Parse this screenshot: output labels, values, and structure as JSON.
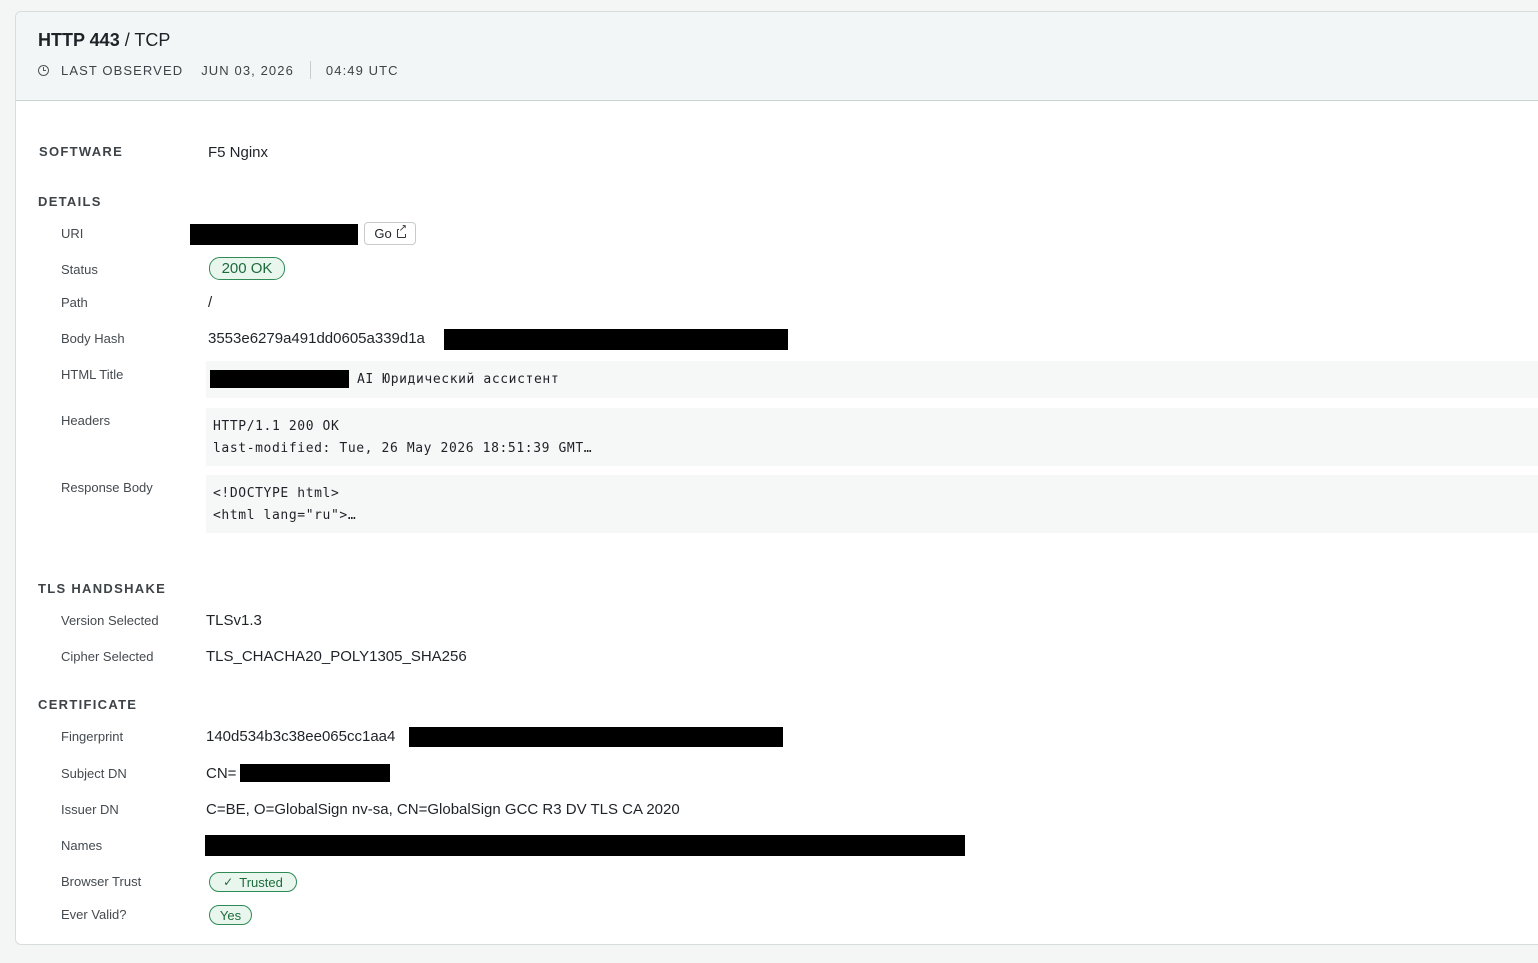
{
  "header": {
    "protocol": "HTTP 443",
    "separator": " / ",
    "transport": "TCP",
    "observed_label": "LAST OBSERVED",
    "observed_date": "JUN 03, 2026",
    "observed_time": "04:49 UTC",
    "clock_icon": "clock-icon"
  },
  "software": {
    "label": "SOFTWARE",
    "value": "F5 Nginx"
  },
  "details": {
    "label": "DETAILS",
    "uri_label": "URI",
    "go_label": "Go",
    "go_icon": "external-link-icon",
    "status_label": "Status",
    "status_value": "200 OK",
    "path_label": "Path",
    "path_value": "/",
    "body_hash_label": "Body Hash",
    "body_hash_value": "3553e6279a491dd0605a339d1a",
    "html_title_label": "HTML Title",
    "html_title_value": "AI Юридический ассистент",
    "headers_label": "Headers",
    "headers_lines": [
      "HTTP/1.1 200 OK",
      "last-modified: Tue, 26 May 2026 18:51:39 GMT…"
    ],
    "response_body_label": "Response Body",
    "response_body_lines": [
      "<!DOCTYPE html>",
      "<html lang=\"ru\">…"
    ]
  },
  "tls": {
    "label": "TLS HANDSHAKE",
    "version_label": "Version Selected",
    "version_value": "TLSv1.3",
    "cipher_label": "Cipher Selected",
    "cipher_value": "TLS_CHACHA20_POLY1305_SHA256"
  },
  "certificate": {
    "label": "CERTIFICATE",
    "fingerprint_label": "Fingerprint",
    "fingerprint_value": "140d534b3c38ee065cc1aa4",
    "subject_label": "Subject DN",
    "subject_value": "CN=",
    "issuer_label": "Issuer DN",
    "issuer_value": "C=BE, O=GlobalSign nv-sa, CN=GlobalSign GCC R3 DV TLS CA 2020",
    "names_label": "Names",
    "browser_trust_label": "Browser Trust",
    "browser_trust_value": "Trusted",
    "browser_trust_icon": "check-icon",
    "ever_valid_label": "Ever Valid?",
    "ever_valid_value": "Yes"
  },
  "colors": {
    "badge_border": "#2f8a55",
    "badge_fill": "#e9f6ee",
    "header_bg": "#f2f6f6",
    "redaction": "#000000"
  }
}
